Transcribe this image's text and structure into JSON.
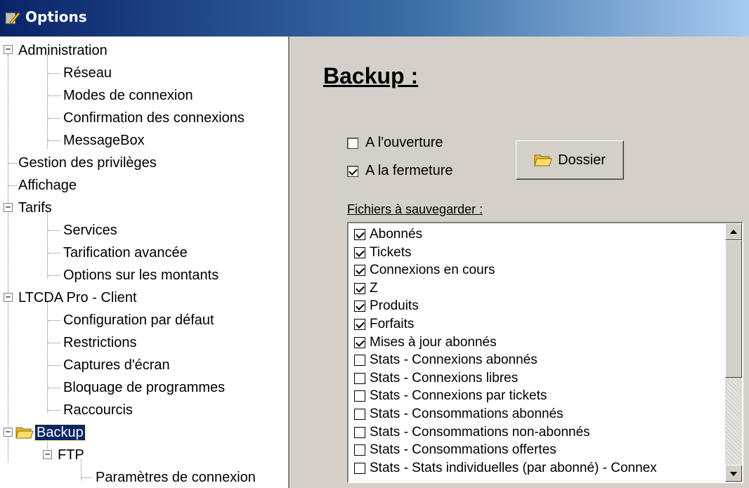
{
  "window": {
    "title": "Options"
  },
  "tree": {
    "items": [
      {
        "label": "Administration"
      },
      {
        "label": "Réseau"
      },
      {
        "label": "Modes de connexion"
      },
      {
        "label": "Confirmation des connexions"
      },
      {
        "label": "MessageBox"
      },
      {
        "label": "Gestion des privilèges"
      },
      {
        "label": "Affichage"
      },
      {
        "label": "Tarifs"
      },
      {
        "label": "Services"
      },
      {
        "label": "Tarification avancée"
      },
      {
        "label": "Options sur les montants"
      },
      {
        "label": "LTCDA Pro - Client"
      },
      {
        "label": "Configuration par défaut"
      },
      {
        "label": "Restrictions"
      },
      {
        "label": "Captures d'écran"
      },
      {
        "label": "Bloquage de programmes"
      },
      {
        "label": "Raccourcis"
      },
      {
        "label": "Backup"
      },
      {
        "label": "FTP"
      },
      {
        "label": "Paramètres de connexion"
      }
    ]
  },
  "panel": {
    "heading": "Backup :",
    "on_open_label": "A l'ouverture",
    "on_open_checked": false,
    "on_close_label": "A la fermeture",
    "on_close_checked": true,
    "folder_button_label": "Dossier",
    "files_label": "Fichiers à sauvegarder :",
    "files": [
      {
        "label": "Abonnés",
        "checked": true
      },
      {
        "label": "Tickets",
        "checked": true
      },
      {
        "label": "Connexions en cours",
        "checked": true
      },
      {
        "label": "Z",
        "checked": true
      },
      {
        "label": "Produits",
        "checked": true
      },
      {
        "label": "Forfaits",
        "checked": true
      },
      {
        "label": "Mises à jour abonnés",
        "checked": true
      },
      {
        "label": "Stats - Connexions abonnés",
        "checked": false
      },
      {
        "label": "Stats - Connexions libres",
        "checked": false
      },
      {
        "label": "Stats - Connexions par tickets",
        "checked": false
      },
      {
        "label": "Stats - Consommations abonnés",
        "checked": false
      },
      {
        "label": "Stats - Consommations non-abonnés",
        "checked": false
      },
      {
        "label": "Stats - Consommations offertes",
        "checked": false
      },
      {
        "label": "Stats - Stats individuelles (par abonné) - Connex",
        "checked": false
      }
    ]
  },
  "colors": {
    "title_bar": "#0a246a",
    "selection": "#0a246a",
    "panel_bg": "#d4d0c8"
  }
}
